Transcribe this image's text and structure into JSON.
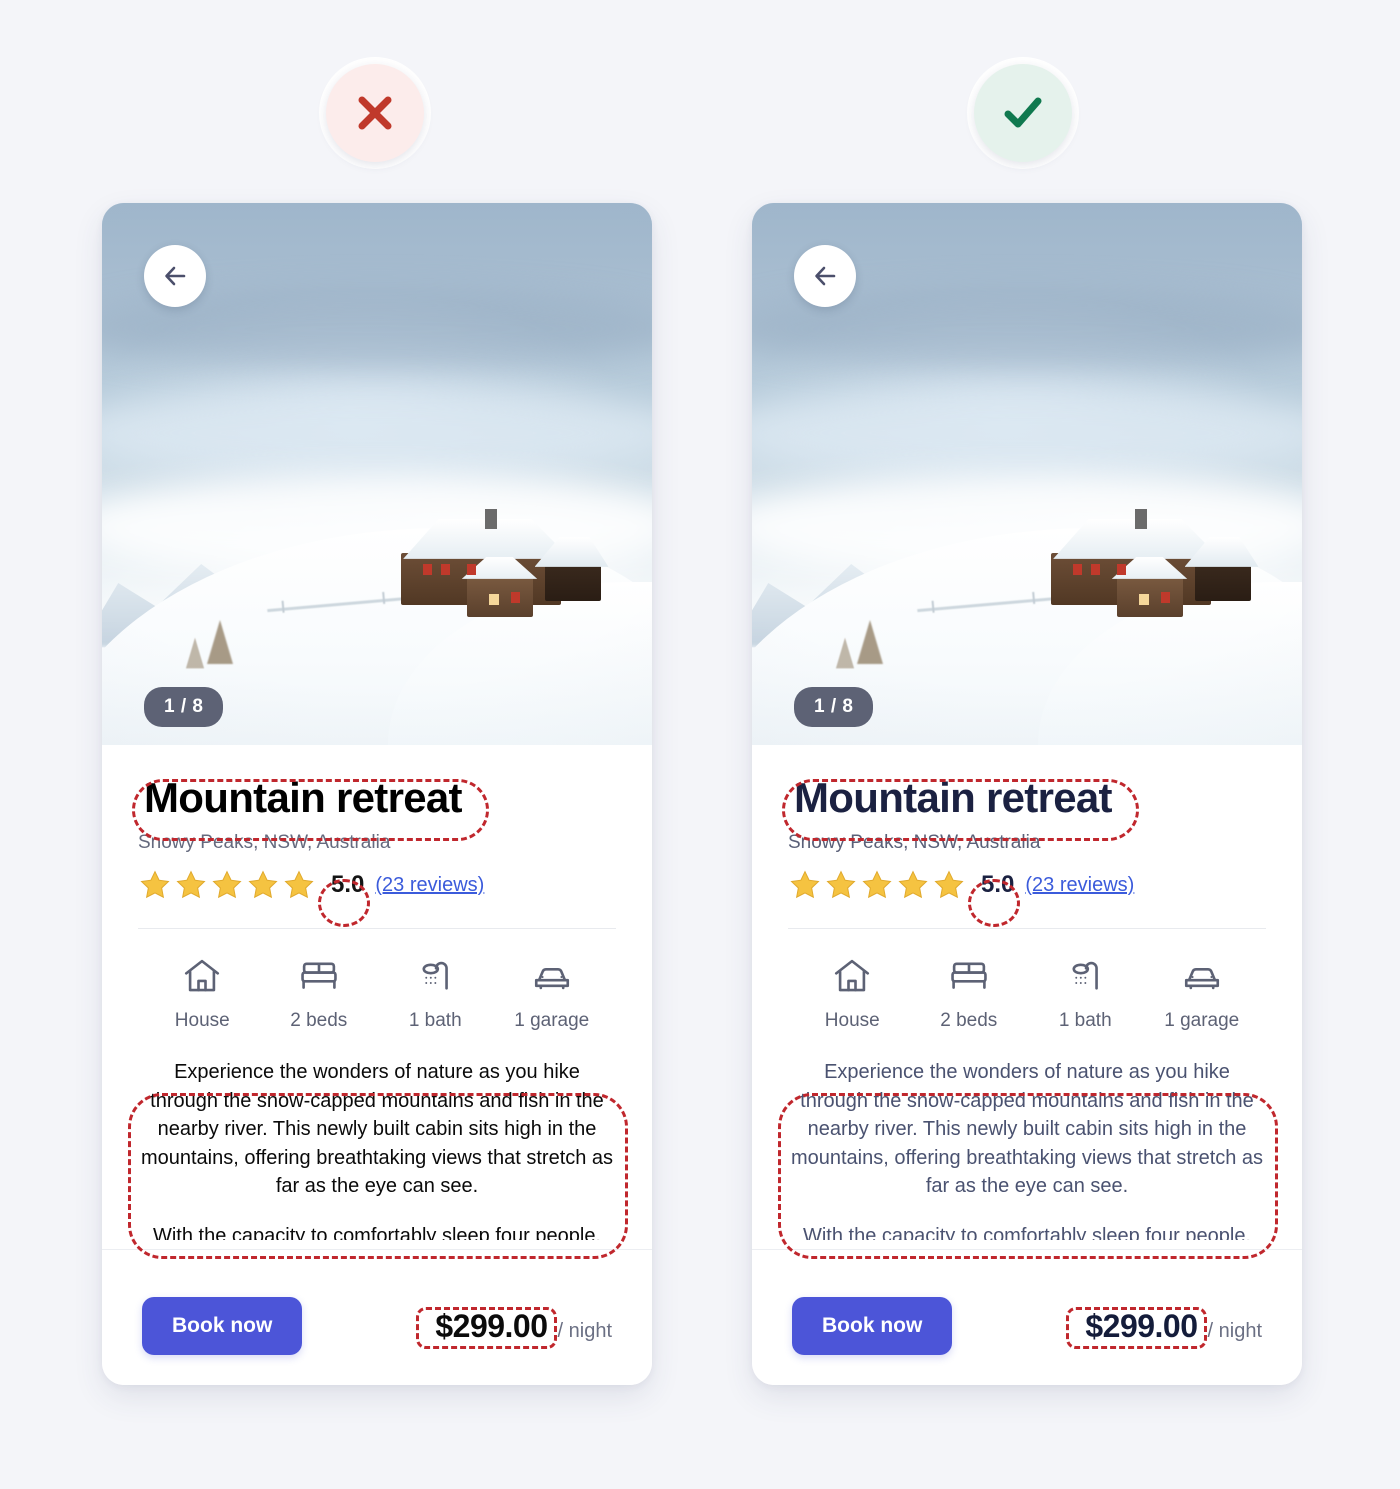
{
  "page": {
    "background": "#f4f5f9",
    "annotation_color": "#c0272d"
  },
  "comparison": {
    "bad": {
      "badge_icon": "cross-icon",
      "badge_bg": "#fceceb",
      "badge_fg": "#c0392b"
    },
    "good": {
      "badge_icon": "check-icon",
      "badge_bg": "#e5f2ec",
      "badge_fg": "#10794f"
    }
  },
  "listing": {
    "back_icon": "arrow-left-icon",
    "photo_counter": "1 / 8",
    "title": "Mountain retreat",
    "subtitle": "Snowy Peaks, NSW, Australia",
    "rating": {
      "stars": 5,
      "score": "5.0",
      "reviews_label": "(23 reviews)",
      "star_color": "#f5c341",
      "link_color": "#3b5bdb"
    },
    "amenities": [
      {
        "icon": "house-icon",
        "label": "House"
      },
      {
        "icon": "bed-icon",
        "label": "2 beds"
      },
      {
        "icon": "shower-icon",
        "label": "1 bath"
      },
      {
        "icon": "car-icon",
        "label": "1 garage"
      }
    ],
    "description": {
      "paragraph_1": "Experience the wonders of nature as you hike through the snow-capped mountains and fish in the nearby river. This newly built cabin sits high in the mountains, offering breathtaking views that stretch as far as the eye can see.",
      "paragraph_2": "With the capacity to comfortably sleep four people, this cozy retreat provides an intimate"
    },
    "footer": {
      "book_label": "Book now",
      "price": "$299.00",
      "per_night": "/ night",
      "button_color": "#4c55d8"
    }
  }
}
